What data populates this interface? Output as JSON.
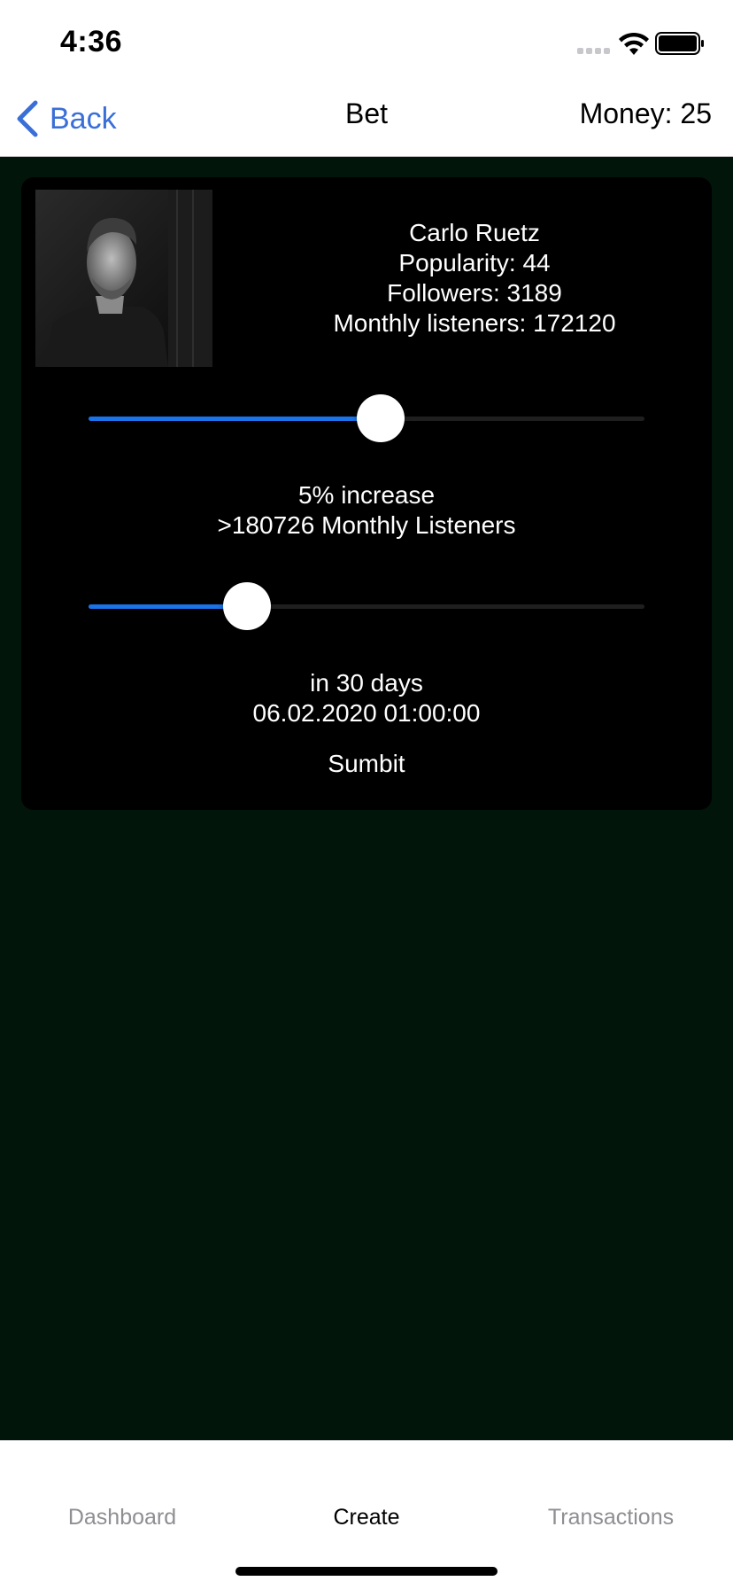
{
  "status_bar": {
    "time": "4:36",
    "icons": [
      "cellular-signal-icon",
      "wifi-icon",
      "battery-icon"
    ]
  },
  "nav": {
    "back_label": "Back",
    "back_icon": "chevron-left-icon",
    "title": "Bet",
    "money": "Money: 25"
  },
  "colors": {
    "accent": "#3a6fd8",
    "slider_fill": "#1a73e8",
    "background": "#02150a",
    "card": "#000000"
  },
  "artist": {
    "name": "Carlo Ruetz",
    "popularity": "Popularity: 44",
    "followers": "Followers: 3189",
    "monthly_listeners": "Monthly listeners: 172120"
  },
  "increase_slider": {
    "value_fraction": 0.525
  },
  "increase": {
    "percent_text": "5% increase",
    "target_text": ">180726 Monthly Listeners"
  },
  "days_slider": {
    "value_fraction": 0.285
  },
  "deadline": {
    "days_text": "in 30 days",
    "date_text": "06.02.2020 01:00:00"
  },
  "submit_label": "Sumbit",
  "tabs": [
    {
      "label": "Dashboard",
      "active": false
    },
    {
      "label": "Create",
      "active": true
    },
    {
      "label": "Transactions",
      "active": false
    }
  ]
}
